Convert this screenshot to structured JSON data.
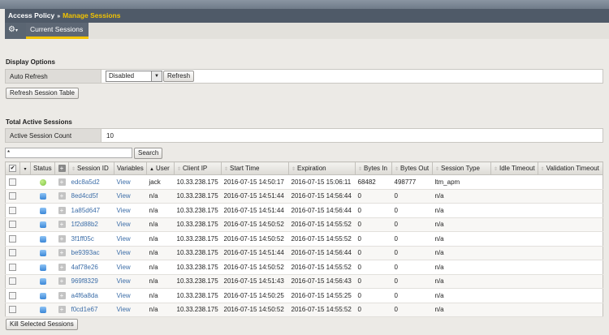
{
  "breadcrumb": {
    "parent": "Access Policy",
    "separator": "»",
    "current": "Manage Sessions"
  },
  "tabs": [
    {
      "label": "Current Sessions"
    }
  ],
  "display_options": {
    "title": "Display Options",
    "auto_refresh_label": "Auto Refresh",
    "auto_refresh_value": "Disabled",
    "refresh_button": "Refresh",
    "refresh_table_button": "Refresh Session Table"
  },
  "total_active": {
    "title": "Total Active Sessions",
    "count_label": "Active Session Count",
    "count_value": "10"
  },
  "search": {
    "value": "*",
    "button": "Search"
  },
  "table": {
    "columns": [
      "Status",
      "Session ID",
      "Variables",
      "User",
      "Client IP",
      "Start Time",
      "Expiration",
      "Bytes In",
      "Bytes Out",
      "Session Type",
      "Idle Timeout",
      "Validation Timeout"
    ],
    "rows": [
      {
        "status": "active",
        "id": "edc8a5d2",
        "vars": "View",
        "user": "jack",
        "ip": "10.33.238.175",
        "start": "2016-07-15 14:50:17",
        "exp": "2016-07-15 15:06:11",
        "in": "68482",
        "out": "498777",
        "type": "ltm_apm"
      },
      {
        "status": "pending",
        "id": "8ed4cd5f",
        "vars": "View",
        "user": "n/a",
        "ip": "10.33.238.175",
        "start": "2016-07-15 14:51:44",
        "exp": "2016-07-15 14:56:44",
        "in": "0",
        "out": "0",
        "type": "n/a"
      },
      {
        "status": "pending",
        "id": "1a85d647",
        "vars": "View",
        "user": "n/a",
        "ip": "10.33.238.175",
        "start": "2016-07-15 14:51:44",
        "exp": "2016-07-15 14:56:44",
        "in": "0",
        "out": "0",
        "type": "n/a"
      },
      {
        "status": "pending",
        "id": "1f2d88b2",
        "vars": "View",
        "user": "n/a",
        "ip": "10.33.238.175",
        "start": "2016-07-15 14:50:52",
        "exp": "2016-07-15 14:55:52",
        "in": "0",
        "out": "0",
        "type": "n/a"
      },
      {
        "status": "pending",
        "id": "3f1ff05c",
        "vars": "View",
        "user": "n/a",
        "ip": "10.33.238.175",
        "start": "2016-07-15 14:50:52",
        "exp": "2016-07-15 14:55:52",
        "in": "0",
        "out": "0",
        "type": "n/a"
      },
      {
        "status": "pending",
        "id": "be9393ac",
        "vars": "View",
        "user": "n/a",
        "ip": "10.33.238.175",
        "start": "2016-07-15 14:51:44",
        "exp": "2016-07-15 14:56:44",
        "in": "0",
        "out": "0",
        "type": "n/a"
      },
      {
        "status": "pending",
        "id": "4af78e26",
        "vars": "View",
        "user": "n/a",
        "ip": "10.33.238.175",
        "start": "2016-07-15 14:50:52",
        "exp": "2016-07-15 14:55:52",
        "in": "0",
        "out": "0",
        "type": "n/a"
      },
      {
        "status": "pending",
        "id": "969f8329",
        "vars": "View",
        "user": "n/a",
        "ip": "10.33.238.175",
        "start": "2016-07-15 14:51:43",
        "exp": "2016-07-15 14:56:43",
        "in": "0",
        "out": "0",
        "type": "n/a"
      },
      {
        "status": "pending",
        "id": "a4f6a8da",
        "vars": "View",
        "user": "n/a",
        "ip": "10.33.238.175",
        "start": "2016-07-15 14:50:25",
        "exp": "2016-07-15 14:55:25",
        "in": "0",
        "out": "0",
        "type": "n/a"
      },
      {
        "status": "pending",
        "id": "f0cd1e67",
        "vars": "View",
        "user": "n/a",
        "ip": "10.33.238.175",
        "start": "2016-07-15 14:50:52",
        "exp": "2016-07-15 14:55:52",
        "in": "0",
        "out": "0",
        "type": "n/a"
      }
    ]
  },
  "kill_button": "Kill Selected Sessions",
  "colors": {
    "accent": "#f2c300",
    "active": "#7cc242",
    "pending": "#3a86d6",
    "link": "#3d6ea8"
  }
}
